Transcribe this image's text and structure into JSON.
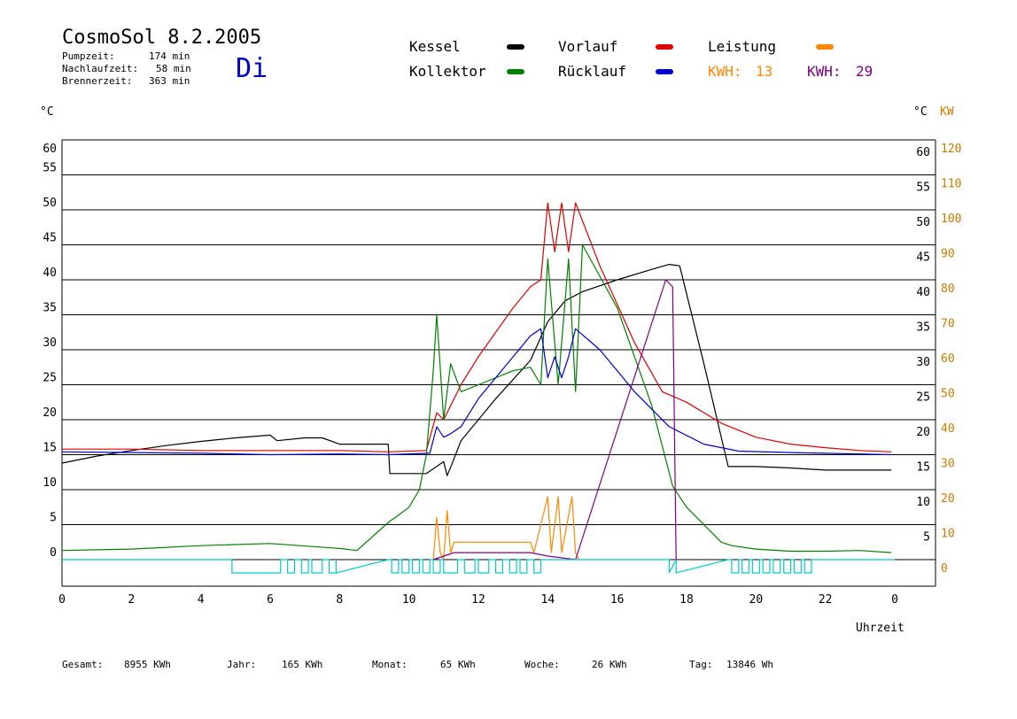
{
  "header": {
    "title": "CosmoSol 8.2.2005",
    "day": "Di",
    "times": [
      {
        "label": "Pumpzeit:",
        "value": "174 min"
      },
      {
        "label": "Nachlaufzeit:",
        "value": "58 min"
      },
      {
        "label": "Brennerzeit:",
        "value": "363 min"
      }
    ]
  },
  "legend": {
    "kessel": "Kessel",
    "kollektor": "Kollektor",
    "vorlauf": "Vorlauf",
    "ruecklauf": "Rücklauf",
    "leistung": "Leistung",
    "kwh1_label": "KWH:",
    "kwh1_value": "13",
    "kwh2_label": "KWH:",
    "kwh2_value": "29"
  },
  "colors": {
    "kessel": "#000000",
    "kollektor": "#008000",
    "vorlauf": "#dd0000",
    "ruecklauf": "#0000cc",
    "leistung": "#ff8800",
    "purple": "#800080",
    "cyan": "#00cccc",
    "kw_axis": "#cc7a00"
  },
  "footer": [
    {
      "label": "Gesamt:",
      "value": "8955 KWh"
    },
    {
      "label": "Jahr:",
      "value": "165 KWh"
    },
    {
      "label": "Monat:",
      "value": "65 KWh"
    },
    {
      "label": "Woche:",
      "value": "26 KWh"
    },
    {
      "label": "Tag:",
      "value": "13846 Wh"
    }
  ],
  "chart_data": {
    "type": "line",
    "xlabel": "Uhrzeit",
    "ylabel_left": "°C",
    "ylabel_right": "°C",
    "ylabel_right2": "KW",
    "xlim": [
      0,
      24
    ],
    "ylim": [
      0,
      60
    ],
    "y2lim": [
      0,
      120
    ],
    "x_ticks": [
      "0",
      "2",
      "4",
      "6",
      "8",
      "10",
      "12",
      "14",
      "16",
      "18",
      "20",
      "22",
      "0"
    ],
    "y_ticks": [
      0,
      5,
      10,
      15,
      20,
      25,
      30,
      35,
      40,
      45,
      50,
      55,
      60
    ],
    "y2_ticks": [
      0,
      10,
      20,
      30,
      40,
      50,
      60,
      70,
      80,
      90,
      100,
      110,
      120
    ],
    "grid": true,
    "series": [
      {
        "name": "Kessel",
        "color": "#000000",
        "x": [
          0,
          1,
          2,
          3,
          4,
          5,
          6,
          6.2,
          7,
          7.5,
          8,
          9.4,
          9.45,
          10.5,
          11,
          11.1,
          11.2,
          11.5,
          12.5,
          13.5,
          14,
          14.5,
          15,
          16,
          17,
          17.5,
          17.8,
          18.5,
          19.2,
          20,
          21,
          22,
          23,
          23.9
        ],
        "y": [
          13.8,
          14.8,
          15.6,
          16.3,
          16.9,
          17.4,
          17.8,
          17.0,
          17.4,
          17.4,
          16.5,
          16.5,
          12.3,
          12.3,
          14.0,
          12.0,
          13.2,
          17.0,
          23.0,
          28.5,
          34.0,
          37.0,
          38.3,
          40.0,
          41.5,
          42.2,
          42.0,
          28.0,
          13.3,
          13.3,
          13.1,
          12.8,
          12.8,
          12.8
        ]
      },
      {
        "name": "Vorlauf",
        "color": "#dd0000",
        "x": [
          0,
          2,
          4,
          6,
          8,
          9.4,
          10.5,
          10.8,
          11.0,
          11.5,
          12,
          13,
          13.5,
          13.8,
          14.0,
          14.2,
          14.4,
          14.6,
          14.8,
          15.5,
          16.5,
          17.3,
          18,
          19,
          20,
          21,
          22,
          23,
          23.9
        ],
        "y": [
          15.8,
          15.8,
          15.6,
          15.6,
          15.6,
          15.4,
          15.6,
          21.0,
          20.0,
          25.0,
          29.0,
          36.0,
          39.0,
          40.0,
          51.0,
          44.0,
          51.0,
          44.0,
          51.0,
          42.0,
          31.0,
          24.0,
          22.5,
          19.5,
          17.5,
          16.5,
          16.0,
          15.6,
          15.4
        ]
      },
      {
        "name": "Kollektor",
        "color": "#008000",
        "x": [
          0,
          2,
          4,
          6,
          8,
          8.5,
          9.45,
          9.6,
          10,
          10.3,
          10.5,
          10.7,
          10.8,
          11.0,
          11.2,
          11.5,
          12,
          13,
          13.5,
          13.8,
          14.0,
          14.3,
          14.6,
          14.8,
          15,
          16,
          17,
          17.6,
          18,
          19,
          19.3,
          20,
          21,
          22,
          23,
          23.9
        ],
        "y": [
          1.3,
          1.5,
          2.0,
          2.3,
          1.6,
          1.3,
          5.5,
          6.0,
          7.5,
          10.0,
          15.0,
          27.0,
          35.0,
          20.0,
          28.0,
          24.0,
          25.0,
          27.0,
          27.5,
          25.0,
          43.0,
          25.0,
          43.0,
          24.0,
          45.0,
          36.0,
          22.0,
          10.5,
          7.5,
          2.5,
          2.0,
          1.5,
          1.2,
          1.2,
          1.3,
          1.0
        ]
      },
      {
        "name": "Rücklauf",
        "color": "#0000cc",
        "x": [
          0,
          2,
          4,
          6,
          8,
          9.4,
          10.6,
          10.8,
          11.0,
          11.2,
          11.5,
          12,
          13,
          13.5,
          13.8,
          14.0,
          14.2,
          14.4,
          14.6,
          14.8,
          15.5,
          16.5,
          17.5,
          18.5,
          19.5,
          21,
          22,
          23,
          23.9
        ],
        "y": [
          15.4,
          15.3,
          15.2,
          15.0,
          15.1,
          15.0,
          15.2,
          19.0,
          17.5,
          18.0,
          19.0,
          23.0,
          29.0,
          32.0,
          33.0,
          26.0,
          29.0,
          26.0,
          29.0,
          33.0,
          30.0,
          24.0,
          19.0,
          16.5,
          15.5,
          15.3,
          15.2,
          15.1,
          15.0
        ]
      },
      {
        "name": "Leistung",
        "color": "#ff8800",
        "axis": "y2",
        "x": [
          10.7,
          10.8,
          10.9,
          11.0,
          11.1,
          11.2,
          11.3,
          11.5,
          12.5,
          13.5,
          13.6,
          14.0,
          14.1,
          14.3,
          14.4,
          14.7,
          14.8,
          14.9
        ],
        "y": [
          0,
          12,
          2,
          0,
          14,
          2,
          5,
          5,
          5,
          5,
          2,
          18,
          2,
          18,
          2,
          18,
          2,
          0
        ]
      },
      {
        "name": "KWH 29",
        "color": "#800080",
        "axis": "y2",
        "x": [
          10.7,
          11.3,
          12,
          13.5,
          14.0,
          14.8,
          17.4,
          17.6,
          17.7
        ],
        "y": [
          0,
          2,
          2,
          2,
          1,
          0,
          80,
          78,
          0
        ]
      }
    ]
  }
}
